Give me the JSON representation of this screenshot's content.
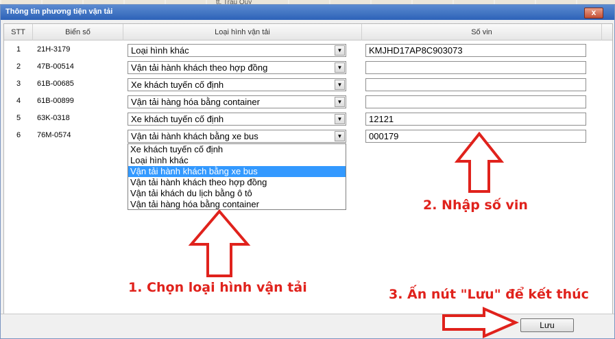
{
  "map": {
    "label": "tt. Trâu Quỳ"
  },
  "dialog": {
    "title": "Thông tin phương tiện vận tải",
    "close_label": "x"
  },
  "table": {
    "headers": [
      "STT",
      "Biển số",
      "Loại hình vận tải",
      "Số vin"
    ],
    "rows": [
      {
        "stt": "1",
        "plate": "21H-3179",
        "type": "Loại hình khác",
        "vin": "KMJHD17AP8C903073"
      },
      {
        "stt": "2",
        "plate": "47B-00514",
        "type": "Vận tải hành khách theo hợp đồng",
        "vin": ""
      },
      {
        "stt": "3",
        "plate": "61B-00685",
        "type": "Xe khách tuyến cố định",
        "vin": ""
      },
      {
        "stt": "4",
        "plate": "61B-00899",
        "type": "Vận tải hàng hóa bằng container",
        "vin": ""
      },
      {
        "stt": "5",
        "plate": "63K-0318",
        "type": "Xe khách tuyến cố định",
        "vin": "12121"
      },
      {
        "stt": "6",
        "plate": "76M-0574",
        "type": "Vận tải hành khách bằng xe bus",
        "vin": "000179"
      }
    ]
  },
  "dropdown": {
    "options": [
      "Xe khách tuyến cố định",
      "Loại hình khác",
      "Vận tải hành khách bằng xe bus",
      "Vận tải hành khách theo hợp đồng",
      "Vận tải khách du lịch bằng ô tô",
      "Vận tải hàng hóa bằng container"
    ],
    "selected_index": 2
  },
  "footer": {
    "save_label": "Lưu"
  },
  "annotations": {
    "step1": "1. Chọn loại hình vận tải",
    "step2": "2. Nhập số vin",
    "step3": "3. Ấn nút \"Lưu\" để kết thúc",
    "color": "#e0221c"
  },
  "colors": {
    "titlebar": "#2d62b8",
    "highlight": "#3399ff"
  }
}
